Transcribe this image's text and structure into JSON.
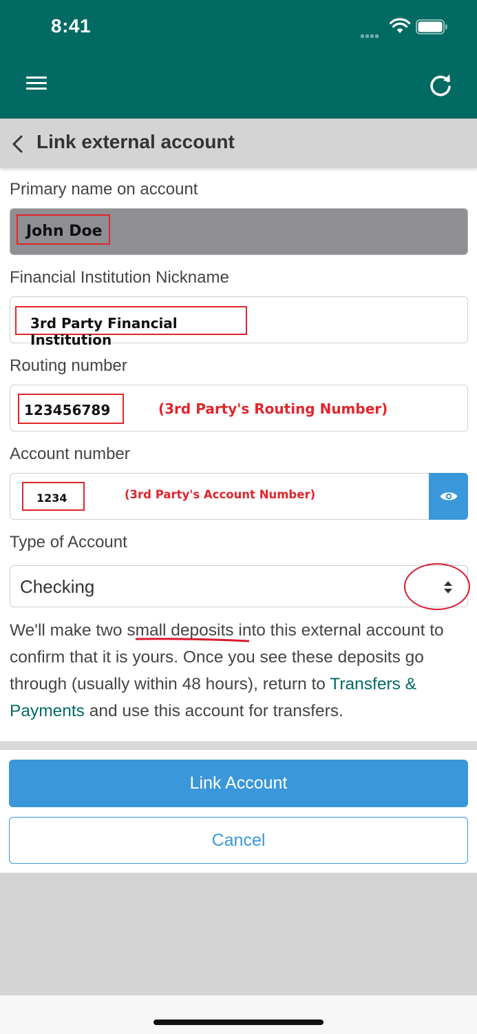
{
  "status_bar": {
    "time": "8:41"
  },
  "header": {
    "menu_icon": "hamburger-menu-icon",
    "refresh_icon": "refresh-icon",
    "back_icon": "chevron-left-icon",
    "title": "Link external account"
  },
  "form": {
    "primary_name": {
      "label": "Primary name on account",
      "value": "John Doe"
    },
    "nickname": {
      "label": "Financial Institution Nickname",
      "value": "3rd Party Financial Institution"
    },
    "routing": {
      "label": "Routing number",
      "value": "123456789",
      "annotation": "(3rd Party's Routing Number)"
    },
    "account": {
      "label": "Account number",
      "value": "1234",
      "annotation": "(3rd Party's Account Number)",
      "toggle_icon": "eye-icon"
    },
    "account_type": {
      "label": "Type of Account",
      "selected": "Checking",
      "icon": "sort-arrows-icon"
    }
  },
  "info": {
    "text_1": "We'll make two ",
    "emphasis": "small deposits",
    "text_2": " into this external account to confirm that it is yours. Once you see these deposits go through (usually within 48 hours), return to ",
    "link": "Transfers & Payments",
    "text_3": " and use this account for transfers."
  },
  "actions": {
    "link_account": "Link Account",
    "cancel": "Cancel"
  },
  "colors": {
    "header_bg": "#016a63",
    "primary_blue": "#3a97da",
    "annotation_red": "#e0252b",
    "disabled_field": "#8e8e93"
  }
}
